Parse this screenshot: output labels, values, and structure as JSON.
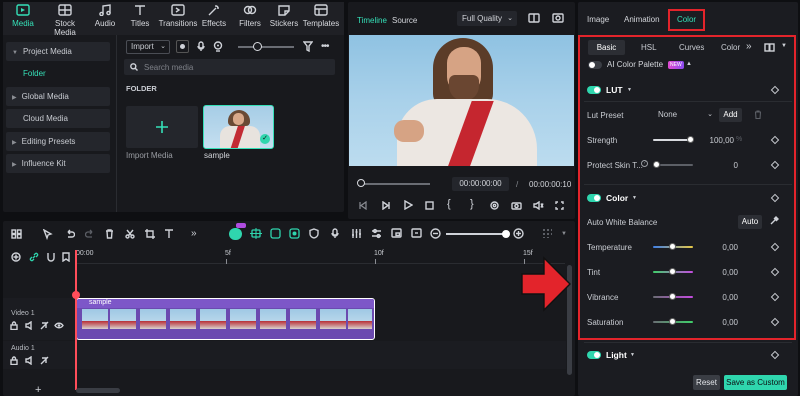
{
  "toolbar": {
    "items": [
      {
        "label": "Media",
        "icon": "media-icon",
        "active": true
      },
      {
        "label": "Stock Media",
        "icon": "stock-media-icon"
      },
      {
        "label": "Audio",
        "icon": "audio-icon"
      },
      {
        "label": "Titles",
        "icon": "titles-icon"
      },
      {
        "label": "Transitions",
        "icon": "transitions-icon"
      },
      {
        "label": "Effects",
        "icon": "effects-icon"
      },
      {
        "label": "Filters",
        "icon": "filters-icon"
      },
      {
        "label": "Stickers",
        "icon": "stickers-icon"
      },
      {
        "label": "Templates",
        "icon": "templates-icon"
      }
    ]
  },
  "sidebar": {
    "items": [
      {
        "label": "Project Media"
      },
      {
        "label": "Folder"
      },
      {
        "label": "Global Media"
      },
      {
        "label": "Cloud Media"
      },
      {
        "label": "Editing Presets"
      },
      {
        "label": "Influence Kit"
      }
    ]
  },
  "media": {
    "import_label": "Import",
    "search_placeholder": "Search media",
    "folder_heading": "FOLDER",
    "import_media_label": "Import Media",
    "sample_label": "sample"
  },
  "preview": {
    "tab_timeline": "Timeline",
    "tab_source": "Source",
    "quality": "Full Quality",
    "current_time": "00:00:00:00",
    "separator": "/",
    "total_time": "00:00:00:10"
  },
  "timeline": {
    "ruler": [
      "00:00",
      "5f",
      "10f",
      "15f"
    ],
    "video_track": "Video 1",
    "audio_track": "Audio 1",
    "clip_name": "sample",
    "add_label": "+"
  },
  "inspector": {
    "tabs": [
      {
        "label": "Image"
      },
      {
        "label": "Animation"
      },
      {
        "label": "Color",
        "active": true
      }
    ],
    "subtabs": [
      {
        "label": "Basic",
        "active": true
      },
      {
        "label": "HSL"
      },
      {
        "label": "Curves"
      },
      {
        "label": "Color"
      }
    ],
    "ai_palette": {
      "label": "AI Color Palette",
      "badge": "NEW"
    },
    "lut": {
      "title": "LUT",
      "preset_label": "Lut Preset",
      "preset_value": "None",
      "add_label": "Add",
      "strength_label": "Strength",
      "strength_value": "100,00",
      "strength_unit": "%",
      "protect_label": "Protect Skin T...",
      "protect_value": "0"
    },
    "color": {
      "title": "Color",
      "awb_label": "Auto White Balance",
      "auto_label": "Auto",
      "rows": [
        {
          "label": "Temperature",
          "value": "0,00",
          "level": 0.5
        },
        {
          "label": "Tint",
          "value": "0,00",
          "level": 0.5
        },
        {
          "label": "Vibrance",
          "value": "0,00",
          "level": 0.5
        },
        {
          "label": "Saturation",
          "value": "0,00",
          "level": 0.5
        }
      ]
    },
    "light": {
      "title": "Light"
    },
    "reset_label": "Reset",
    "save_label": "Save as Custom"
  },
  "colors": {
    "accent": "#2fd6ae",
    "highlight_box": "#e3242b",
    "clip": "#6b4ab0",
    "playhead": "#ff4d5a"
  }
}
